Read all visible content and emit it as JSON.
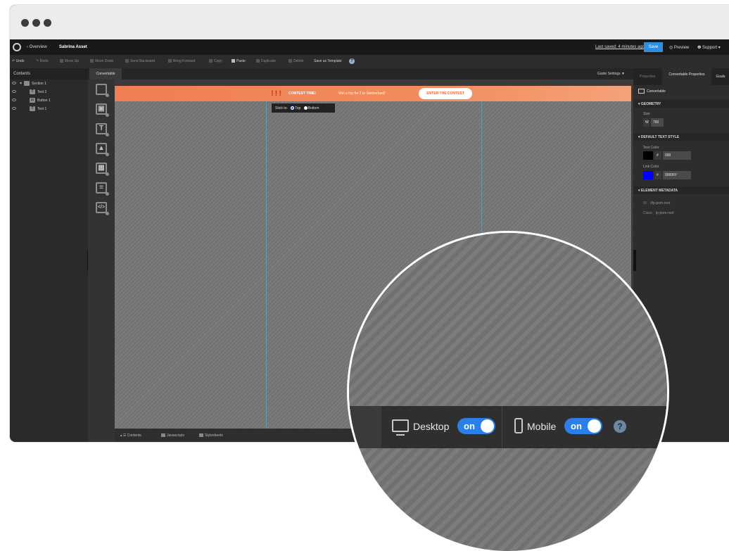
{
  "window_dots": [
    "close",
    "minimize",
    "maximize"
  ],
  "topbar": {
    "back_label": "‹ Overview",
    "asset_name": "Sabrina Asset",
    "last_saved": "Last saved: 4 minutes ago",
    "save_label": "Save",
    "preview_label": "Preview",
    "support_label": "Support"
  },
  "toolbar": {
    "undo": "Undo",
    "redo": "Redo",
    "move_up": "Move Up",
    "move_down": "Move Down",
    "send_backward": "Send Backward",
    "bring_forward": "Bring Forward",
    "copy": "Copy",
    "paste": "Paste",
    "duplicate": "Duplicate",
    "delete": "Delete",
    "save_template": "Save as Template"
  },
  "contents": {
    "header": "Contents",
    "items": [
      {
        "label": "Section 1",
        "icon": "section"
      },
      {
        "label": "Text 2",
        "icon": "T"
      },
      {
        "label": "Button 1",
        "icon": "btn"
      },
      {
        "label": "Text 1",
        "icon": "T"
      }
    ]
  },
  "canvas": {
    "tab_label": "Convertable",
    "guide_settings": "Guide Settings ▼",
    "banner": {
      "exclaim": "!!!",
      "title": "CONTEST TIME!",
      "subtitle": "Win a trip for 2 to Switzerland!",
      "cta": "ENTER THE CONTEST"
    },
    "stick_to": {
      "label": "Stick to:",
      "top": "Top",
      "bottom": "Bottom",
      "selected": "Top"
    },
    "bottom_tabs": [
      "Contents",
      "Javascripts",
      "Stylesheets"
    ]
  },
  "properties": {
    "tabs": [
      "Properties",
      "Convertable Properties",
      "Goals"
    ],
    "active_tab": "Convertable Properties",
    "element_type": "Convertable",
    "geometry_header": "GEOMETRY",
    "size_label": "Size",
    "width_prefix": "W",
    "width_value": "760",
    "text_style_header": "DEFAULT TEXT STYLE",
    "text_color_label": "Text Color",
    "text_color_hex": "000",
    "link_color_label": "Link Color",
    "link_color_hex": "0000FF",
    "hash": "#",
    "metadata_header": "ELEMENT METADATA",
    "id_label": "ID:",
    "id_value": "#lp-pom-root",
    "class_label": "Class:",
    "class_value": "lp-pom-root"
  },
  "magnifier": {
    "desktop_label": "Desktop",
    "desktop_toggle": "on",
    "mobile_label": "Mobile",
    "mobile_toggle": "on",
    "help": "?"
  },
  "colors": {
    "accent_blue": "#2c7fe8",
    "banner_orange": "#f07e53",
    "text_color": "#000000",
    "link_color": "#0000ff"
  }
}
